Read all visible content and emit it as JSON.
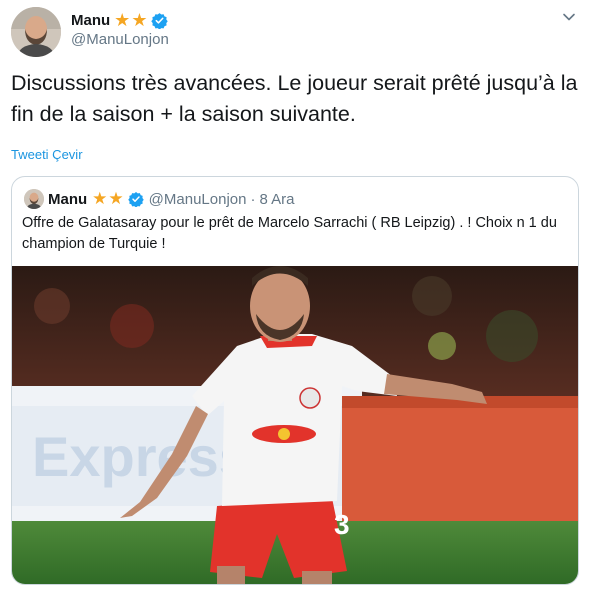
{
  "tweet": {
    "author_name": "Manu",
    "author_handle": "@ManuLonjon",
    "badges": [
      "star-icon",
      "star-icon",
      "verified-icon"
    ],
    "text": "Discussions très avancées. Le joueur serait prêté jusqu’à la fin de la saison + la saison suivante.",
    "translate_link": "Tweeti Çevir"
  },
  "quoted_tweet": {
    "author_name": "Manu",
    "author_handle": "@ManuLonjon",
    "separator": "·",
    "date": "8 Ara",
    "text": "Offre de Galatasaray pour le prêt de Marcelo Sarrachi ( RB Leipzig) . ! Choix n 1 du champion de Turquie !",
    "media": {
      "description_icon": "photo-icon",
      "jersey_number": "3"
    }
  },
  "colors": {
    "star": "#f5a623",
    "verified": "#1da1f2",
    "link": "#1b95e0",
    "secondary_text": "#657786",
    "border": "#ccd6dd"
  }
}
